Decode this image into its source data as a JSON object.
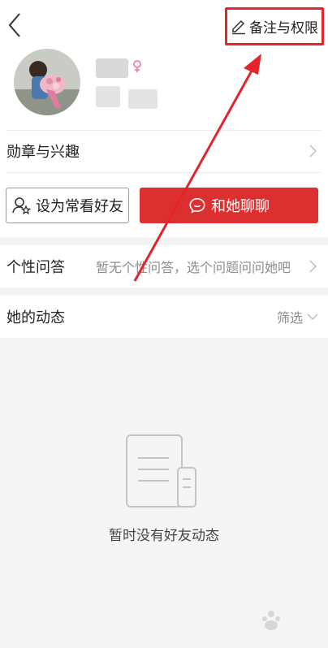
{
  "header": {
    "remark_permission_label": "备注与权限"
  },
  "profile": {
    "name_masked": true
  },
  "medals_row": {
    "label": "勋章与兴趣"
  },
  "actions": {
    "add_favorite_label": "设为常看好友",
    "chat_label": "和她聊聊"
  },
  "qa_row": {
    "label": "个性问答",
    "hint": "暂无个性问答，选个问题问问她吧"
  },
  "activity_row": {
    "label": "她的动态",
    "filter_label": "筛选"
  },
  "empty_state": {
    "message": "暂时没有好友动态"
  },
  "colors": {
    "accent_red": "#dc2f2f",
    "annotation_red": "#e4242b",
    "gender_pink": "#f08fa8"
  },
  "icons": {
    "back": "chevron-left-icon",
    "edit": "pencil-icon",
    "gender": "female-icon",
    "favorite": "user-star-icon",
    "chat": "chat-bubble-icon",
    "empty": "document-icon"
  }
}
